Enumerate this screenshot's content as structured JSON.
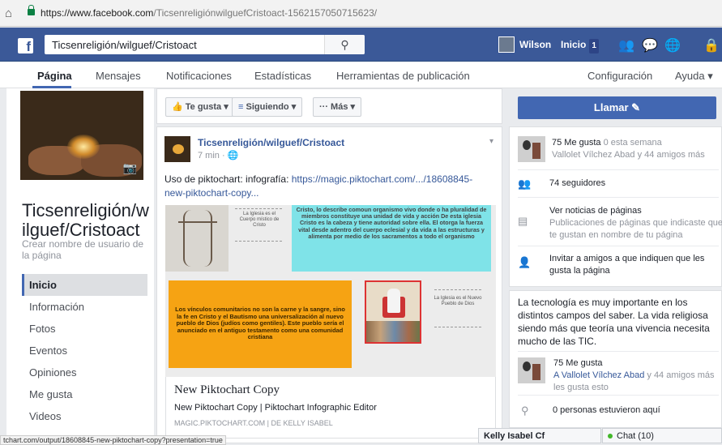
{
  "browser": {
    "url_domain": "https://www.facebook.com",
    "url_path": "/TicsenreligiónwilguefCristoact-1562157050715623/",
    "status_url": "tchart.com/output/18608845-new-piktochart-copy?presentation=true"
  },
  "topbar": {
    "search_value": "Ticsenreligión/wilguef/Cristoact",
    "user_name": "Wilson",
    "home_label": "Inicio",
    "home_count": "1",
    "colors": {
      "brand": "#3b5998",
      "accent": "#4267b2"
    },
    "icons": [
      "friends-icon",
      "messages-icon",
      "globe-icon",
      "settings-icon"
    ]
  },
  "page_nav": {
    "tabs": [
      "Página",
      "Mensajes",
      "Notificaciones",
      "Estadísticas",
      "Herramientas de publicación"
    ],
    "config_label": "Configuración",
    "help_label": "Ayuda ▾"
  },
  "left": {
    "page_name": "Ticsenreligión/wilguef/Cristoact",
    "username_prompt": "Crear nombre de usuario de la página",
    "menu": [
      "Inicio",
      "Información",
      "Fotos",
      "Eventos",
      "Opiniones",
      "Me gusta",
      "Videos"
    ]
  },
  "actions": {
    "like_label": "Te gusta ▾",
    "follow_label": "Siguiendo ▾",
    "more_label": "··· Más ▾"
  },
  "post": {
    "author": "Ticsenreligión/wilguef/Cristoact",
    "time": "7 min · ",
    "text_prefix": "Uso de piktochart: infografía: ",
    "link_text": "https://magic.piktochart.com/.../18608845-new-piktochart-copy...",
    "infographic": {
      "label_top": "La Iglesia es el Cuerpo místico de Cristo",
      "cyan_text": "Cristo, lo describe comoun organismo vivo donde o ha pluralidad de miembros constituye una unidad de vida y acción De esta iglesia Cristo es la cabeza y tiene autoridad sobre ella. El otorga la fuerza vital desde adentro del cuerpo eclesial y da vida a las estructuras y alimenta por medio de los sacramentos a todo el organismo",
      "orange_text": "Los vínculos comunitarios no son la carne y la sangre, sino la fe en Cristo y el Bautismo una universalización al nuevo pueblo de Dios (judíos como gentiles). Este pueblo sería el anunciado en el antiguo testamento como una comunidad cristiana",
      "label_right": "La Iglesia es el Nuevo Pueblo de Dios"
    },
    "link_title": "New Piktochart Copy",
    "link_desc": "New Piktochart Copy | Piktochart Infographic Editor",
    "link_source": "MAGIC.PIKTOCHART.COM | DE KELLY ISABEL"
  },
  "right": {
    "call_label": "Llamar ✎",
    "likes_count": "75 Me gusta",
    "likes_week": " 0 esta semana",
    "likes_friends": "Vallolet Vílchez Abad y 44 amigos más",
    "followers": "74 seguidores",
    "see_news": "Ver noticias de páginas",
    "see_news_desc": "Publicaciones de páginas que indicaste que te gustan en nombre de tu página",
    "invite": "Invitar a amigos a que indiquen que les gusta la página",
    "about_text": "La tecnología es muy importante en los distintos campos del saber. La vida religiosa siendo más que teoría una vivencia necesita mucho de las TIC.",
    "likes2_count": "75 Me gusta",
    "likes2_name": "A Vallolet Vílchez Abad",
    "likes2_rest": " y 44 amigos más les gusta esto",
    "visited": "0 personas estuvieron aquí"
  },
  "chat": {
    "contact": "Kelly Isabel Cf",
    "chat_label": "Chat (10)"
  }
}
